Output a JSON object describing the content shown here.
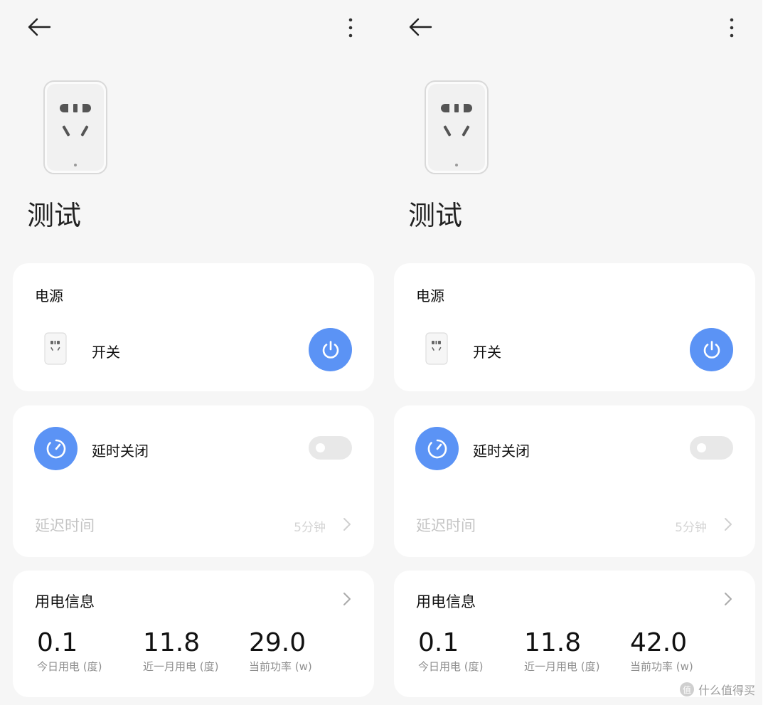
{
  "colors": {
    "accent": "#5b93f5",
    "background": "#f6f6f6",
    "card": "#ffffff"
  },
  "icons": [
    "back-arrow-icon",
    "more-vertical-icon",
    "power-icon",
    "timer-icon",
    "chevron-right-icon",
    "smart-plug-icon"
  ],
  "screens": [
    {
      "device_name": "测试",
      "power": {
        "title": "电源",
        "switch_label": "开关",
        "on": true
      },
      "timer": {
        "label": "延时关闭",
        "enabled": false,
        "delay_label": "延迟时间",
        "delay_value": "5分钟"
      },
      "usage": {
        "title": "用电信息",
        "stats": [
          {
            "value": "0.1",
            "label": "今日用电 (度)"
          },
          {
            "value": "11.8",
            "label": "近一月用电 (度)"
          },
          {
            "value": "29.0",
            "label": "当前功率 (w)"
          }
        ]
      }
    },
    {
      "device_name": "测试",
      "power": {
        "title": "电源",
        "switch_label": "开关",
        "on": true
      },
      "timer": {
        "label": "延时关闭",
        "enabled": false,
        "delay_label": "延迟时间",
        "delay_value": "5分钟"
      },
      "usage": {
        "title": "用电信息",
        "stats": [
          {
            "value": "0.1",
            "label": "今日用电 (度)"
          },
          {
            "value": "11.8",
            "label": "近一月用电 (度)"
          },
          {
            "value": "42.0",
            "label": "当前功率 (w)"
          }
        ]
      }
    }
  ],
  "watermark": {
    "text": "什么值得买"
  }
}
